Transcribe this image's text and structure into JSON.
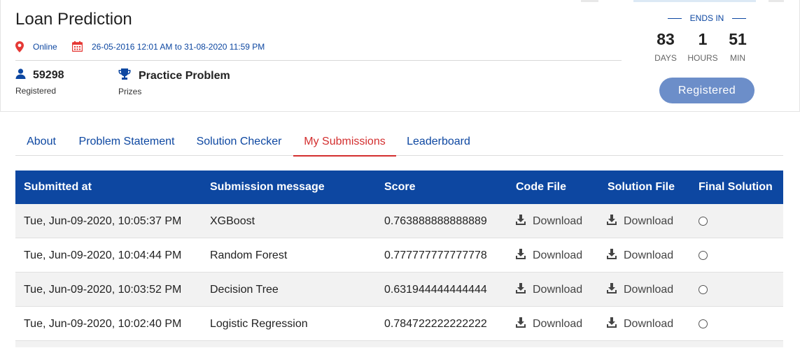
{
  "page": {
    "title": "Loan Prediction",
    "location": "Online",
    "dates": "26-05-2016 12:01 AM to 31-08-2020 11:59 PM",
    "registered_count": "59298",
    "registered_label": "Registered",
    "prize_value": "Practice Problem",
    "prize_label": "Prizes"
  },
  "countdown": {
    "heading": "ENDS IN",
    "days": "83",
    "days_label": "DAYS",
    "hours": "1",
    "hours_label": "HOURS",
    "minutes": "51",
    "minutes_label": "MIN",
    "button_label": "Registered"
  },
  "tabs": [
    {
      "label": "About"
    },
    {
      "label": "Problem Statement"
    },
    {
      "label": "Solution Checker"
    },
    {
      "label": "My Submissions",
      "active": true
    },
    {
      "label": "Leaderboard"
    }
  ],
  "table": {
    "headers": {
      "submitted_at": "Submitted at",
      "message": "Submission message",
      "score": "Score",
      "code_file": "Code File",
      "solution_file": "Solution File",
      "final_solution": "Final Solution"
    },
    "download_label": "Download",
    "rows": [
      {
        "submitted_at": "Tue, Jun-09-2020, 10:05:37 PM",
        "message": "XGBoost",
        "score": "0.763888888888889"
      },
      {
        "submitted_at": "Tue, Jun-09-2020, 10:04:44 PM",
        "message": "Random Forest",
        "score": "0.777777777777778"
      },
      {
        "submitted_at": "Tue, Jun-09-2020, 10:03:52 PM",
        "message": "Decision Tree",
        "score": "0.631944444444444"
      },
      {
        "submitted_at": "Tue, Jun-09-2020, 10:02:40 PM",
        "message": "Logistic Regression",
        "score": "0.784722222222222"
      }
    ]
  },
  "colors": {
    "primary_blue": "#0d47a1",
    "active_red": "#d32f2f",
    "button_blue": "#6c8ec9"
  },
  "icons": {
    "location": "map-pin-icon",
    "calendar": "calendar-icon",
    "user": "user-icon",
    "trophy": "trophy-icon",
    "download": "download-icon",
    "radio": "radio-button"
  }
}
